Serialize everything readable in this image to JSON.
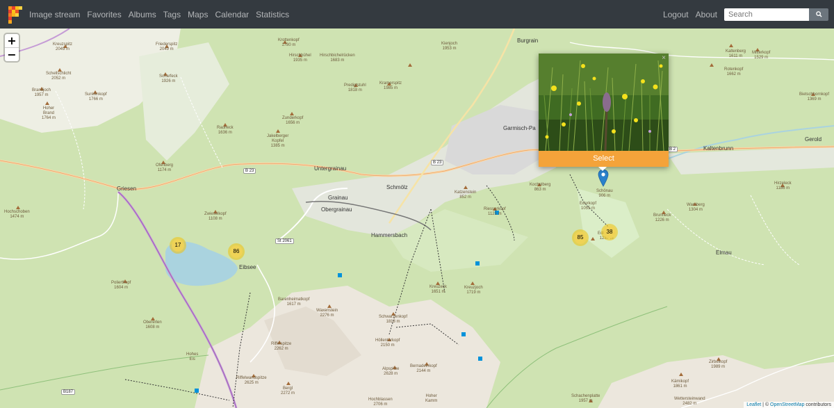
{
  "navbar": {
    "links": [
      "Image stream",
      "Favorites",
      "Albums",
      "Tags",
      "Maps",
      "Calendar",
      "Statistics"
    ],
    "logout": "Logout",
    "about": "About",
    "search_placeholder": "Search"
  },
  "map": {
    "zoom_in": "+",
    "zoom_out": "−",
    "clusters": [
      "17",
      "86",
      "85",
      "38"
    ],
    "popup": {
      "select_label": "Select",
      "close": "×"
    },
    "attribution": {
      "leaflet": "Leaflet",
      "sep": " | © ",
      "osm": "OpenStreetMap",
      "tail": " contributors"
    },
    "towns": [
      "Garmisch-Pa",
      "Untergrainau",
      "Grainau",
      "Obergrainau",
      "Schmölz",
      "Hammersbach",
      "Griesen",
      "Eibsee",
      "Kaltenbrunn",
      "Gerold",
      "Elmau",
      "Burgrain"
    ],
    "roads": [
      "B 23",
      "B 23",
      "St 2061",
      "B187",
      "B 2"
    ],
    "peaks": [
      "Kreuzspitz\n2049 m",
      "Friederspitz\n2049 m",
      "Schellschlicht\n2052 m",
      "Scharfeck\n1926 m",
      "Brandjoch\n1957 m",
      "Sunkenkopf\n1766 m",
      "Hoher\nBrand\n1764 m",
      "Krottenkopf\n1780 m",
      "Hirschbühel\n1935 m",
      "Hirschbichelrücken\n1683 m",
      "Kienjoch\n1953 m",
      "Kramerspitz\n1985 m",
      "Predigtstuhl\n1818 m",
      "Rauheck\n1636 m",
      "Jakelberger\nKopfel\n1385 m",
      "Zunderkopf\n1656 m",
      "Ofenberg\n1174 m",
      "Zwieselkopf\n1108 m",
      "Hochschoben\n1474 m",
      "Katzenstein\n852 m",
      "Riesserkopf\n1121 m",
      "Kochelberg\n863 m",
      "Eckbauer\n1237 m",
      "Wamberg\n1304 m",
      "Brunneck\n1226 m",
      "Kreuzeck\n1651 m",
      "Kreuzjoch\n1719 m",
      "Schwarzenkopf\n1818 m",
      "Höllentorkopf\n2150 m",
      "Alpspitze\n2628 m",
      "Bernadeinkopf\n2144 m",
      "Waxenstein\n2276 m",
      "Riffelspitze\n2262 m",
      "Riffelwandspitze\n2625 m",
      "Bergl\n2272 m",
      "Zirbelkopf\n1989 m",
      "Kämikopf\n1861 m",
      "Wettersteinwand\n2482 m",
      "Hirzeleck\n1186 m",
      "Poliertkopf\n1604 m",
      "Obererlen\n1608 m",
      "Kaltenberg\n1611 m",
      "Mitterkopf\n1529 m",
      "Rotenkopf\n1662 m",
      "Schönau\n906 m",
      "Ederkopf\n1055 m",
      "Barenheimatkopf\n1617 m",
      "Hochblassen\n2706 m",
      "Schachenplatte\n1957 m",
      "Bietschhornkopf\n1369 m",
      "Hoher\nKamm",
      "Hohes\nEis"
    ]
  }
}
